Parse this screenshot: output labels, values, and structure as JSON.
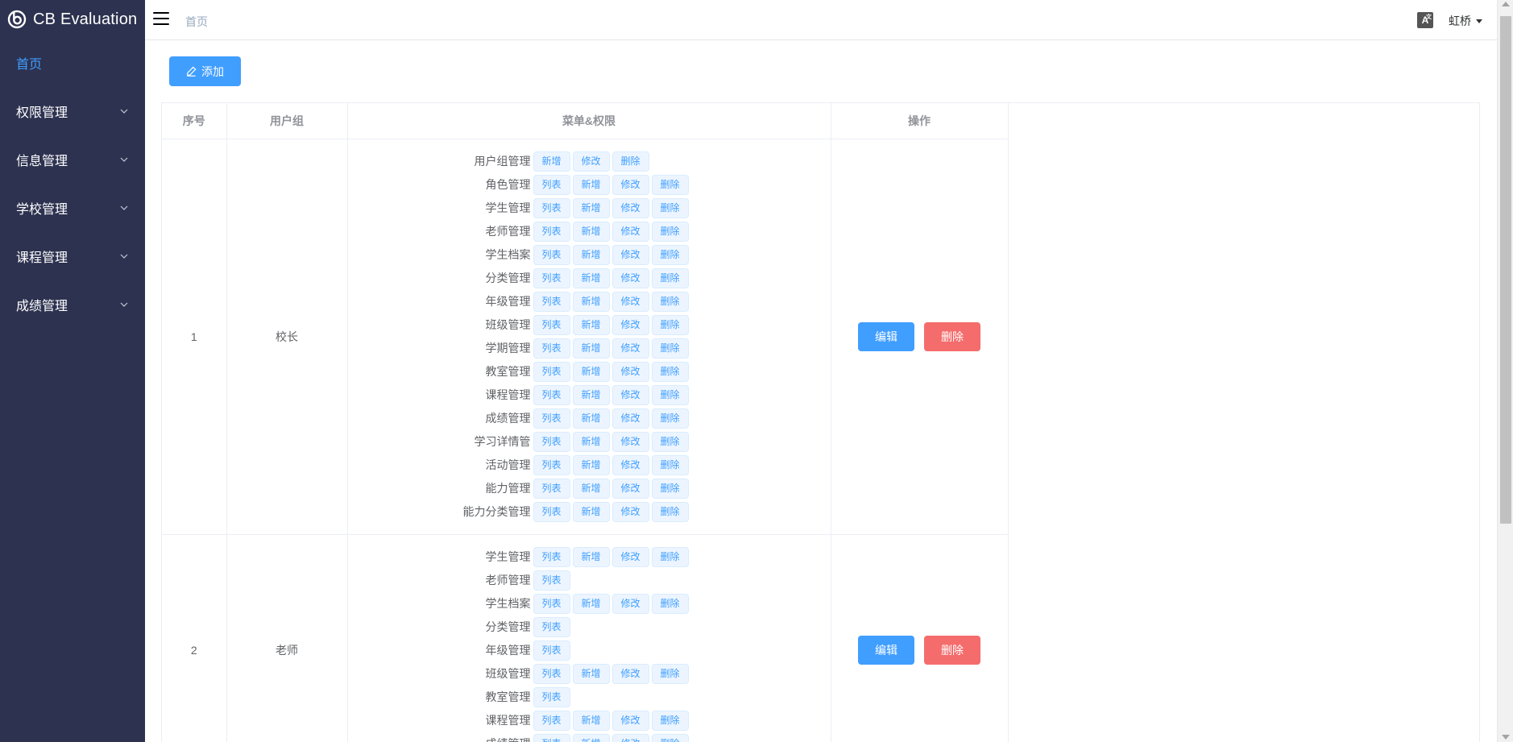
{
  "app": {
    "title": "CB Evaluation"
  },
  "sidebar": {
    "items": [
      {
        "label": "首页",
        "active": true,
        "has_children": false
      },
      {
        "label": "权限管理",
        "has_children": true
      },
      {
        "label": "信息管理",
        "has_children": true
      },
      {
        "label": "学校管理",
        "has_children": true
      },
      {
        "label": "课程管理",
        "has_children": true
      },
      {
        "label": "成绩管理",
        "has_children": true
      }
    ]
  },
  "header": {
    "breadcrumb": "首页",
    "lang_icon": "A",
    "user_name": "虹桥"
  },
  "toolbar": {
    "add_label": "添加",
    "add_icon": "edit-icon"
  },
  "table": {
    "columns": [
      "序号",
      "用户组",
      "菜单&权限",
      "操作"
    ],
    "edit_label": "编辑",
    "delete_label": "删除",
    "rows": [
      {
        "index": "1",
        "group": "校长",
        "permissions": [
          {
            "name": "用户组管理",
            "actions": [
              "新增",
              "修改",
              "删除"
            ]
          },
          {
            "name": "角色管理",
            "actions": [
              "列表",
              "新增",
              "修改",
              "删除"
            ]
          },
          {
            "name": "学生管理",
            "actions": [
              "列表",
              "新增",
              "修改",
              "删除"
            ]
          },
          {
            "name": "老师管理",
            "actions": [
              "列表",
              "新增",
              "修改",
              "删除"
            ]
          },
          {
            "name": "学生档案",
            "actions": [
              "列表",
              "新增",
              "修改",
              "删除"
            ]
          },
          {
            "name": "分类管理",
            "actions": [
              "列表",
              "新增",
              "修改",
              "删除"
            ]
          },
          {
            "name": "年级管理",
            "actions": [
              "列表",
              "新增",
              "修改",
              "删除"
            ]
          },
          {
            "name": "班级管理",
            "actions": [
              "列表",
              "新增",
              "修改",
              "删除"
            ]
          },
          {
            "name": "学期管理",
            "actions": [
              "列表",
              "新增",
              "修改",
              "删除"
            ]
          },
          {
            "name": "教室管理",
            "actions": [
              "列表",
              "新增",
              "修改",
              "删除"
            ]
          },
          {
            "name": "课程管理",
            "actions": [
              "列表",
              "新增",
              "修改",
              "删除"
            ]
          },
          {
            "name": "成绩管理",
            "actions": [
              "列表",
              "新增",
              "修改",
              "删除"
            ]
          },
          {
            "name": "学习详情管",
            "actions": [
              "列表",
              "新增",
              "修改",
              "删除"
            ]
          },
          {
            "name": "活动管理",
            "actions": [
              "列表",
              "新增",
              "修改",
              "删除"
            ]
          },
          {
            "name": "能力管理",
            "actions": [
              "列表",
              "新增",
              "修改",
              "删除"
            ]
          },
          {
            "name": "能力分类管理",
            "actions": [
              "列表",
              "新增",
              "修改",
              "删除"
            ]
          }
        ]
      },
      {
        "index": "2",
        "group": "老师",
        "permissions": [
          {
            "name": "学生管理",
            "actions": [
              "列表",
              "新增",
              "修改",
              "删除"
            ]
          },
          {
            "name": "老师管理",
            "actions": [
              "列表"
            ]
          },
          {
            "name": "学生档案",
            "actions": [
              "列表",
              "新增",
              "修改",
              "删除"
            ]
          },
          {
            "name": "分类管理",
            "actions": [
              "列表"
            ]
          },
          {
            "name": "年级管理",
            "actions": [
              "列表"
            ]
          },
          {
            "name": "班级管理",
            "actions": [
              "列表",
              "新增",
              "修改",
              "删除"
            ]
          },
          {
            "name": "教室管理",
            "actions": [
              "列表"
            ]
          },
          {
            "name": "课程管理",
            "actions": [
              "列表",
              "新增",
              "修改",
              "删除"
            ]
          },
          {
            "name": "成绩管理",
            "actions": [
              "列表",
              "新增",
              "修改",
              "删除"
            ]
          }
        ]
      }
    ]
  },
  "colors": {
    "sidebar_bg": "#2d3250",
    "accent": "#409eff",
    "danger": "#f56c6c"
  }
}
